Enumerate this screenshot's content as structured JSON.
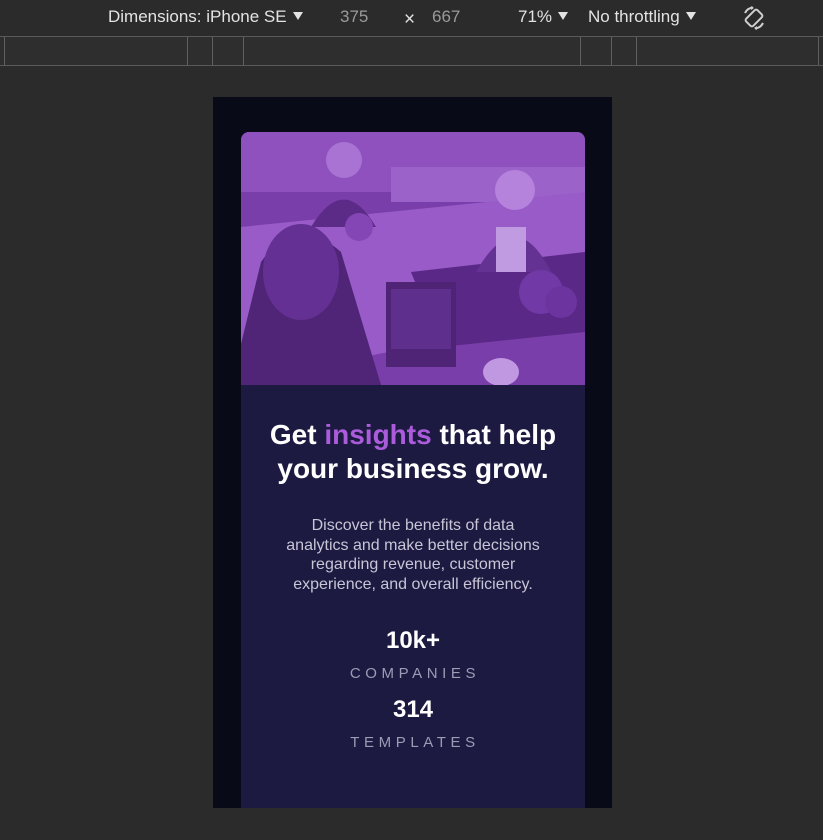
{
  "devtools": {
    "dimensions_label": "Dimensions: iPhone SE",
    "width": "375",
    "times": "×",
    "height": "667",
    "zoom": "71%",
    "throttling": "No throttling"
  },
  "card": {
    "headline_pre": "Get ",
    "headline_accent": "insights",
    "headline_post": " that help your business grow.",
    "description": "Discover the benefits of data analytics and make better decisions regarding revenue, customer experience, and overall efficiency.",
    "stats": [
      {
        "value": "10k+",
        "label": "COMPANIES"
      },
      {
        "value": "314",
        "label": "TEMPLATES"
      }
    ]
  },
  "colors": {
    "page_bg": "#090a18",
    "card_bg": "#1c1a40",
    "accent": "#ab5cdb",
    "muted_text": "#c7c5d6",
    "label_text": "#9d9bb5"
  }
}
